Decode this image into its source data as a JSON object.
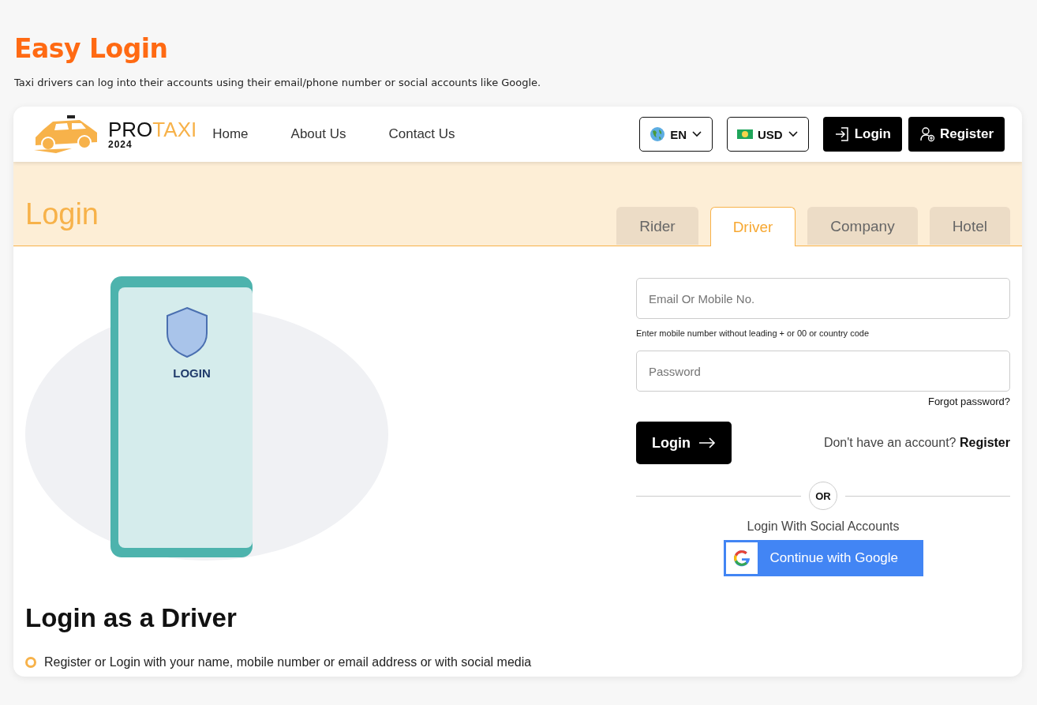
{
  "page": {
    "title": "Easy Login",
    "subtitle": "Taxi drivers can log into their accounts using their email/phone number or social accounts like Google."
  },
  "header": {
    "logo": {
      "word1": "PRO",
      "word2": "TAXI",
      "year": "2024"
    },
    "nav": [
      "Home",
      "About Us",
      "Contact Us"
    ],
    "language": "EN",
    "currency": "USD",
    "login_button": "Login",
    "register_button": "Register"
  },
  "login": {
    "title": "Login",
    "tabs": [
      {
        "label": "Rider",
        "selected": false
      },
      {
        "label": "Driver",
        "selected": true
      },
      {
        "label": "Company",
        "selected": false
      },
      {
        "label": "Hotel",
        "selected": false
      }
    ],
    "email": {
      "placeholder": "Email Or Mobile No."
    },
    "hint": "Enter mobile number without leading + or 00 or country code",
    "password": {
      "placeholder": "Password"
    },
    "forgot": "Forgot password?",
    "submit": "Login",
    "no_account": "Don't have an account?",
    "register_link": "Register",
    "or": "OR",
    "social_title": "Login With Social Accounts",
    "google_button": "Continue with Google"
  },
  "illustration": {
    "screen_label": "LOGIN"
  },
  "info": {
    "heading": "Login as a Driver",
    "bullets": [
      "Register or Login with your name, mobile number or email address or with social media"
    ]
  }
}
